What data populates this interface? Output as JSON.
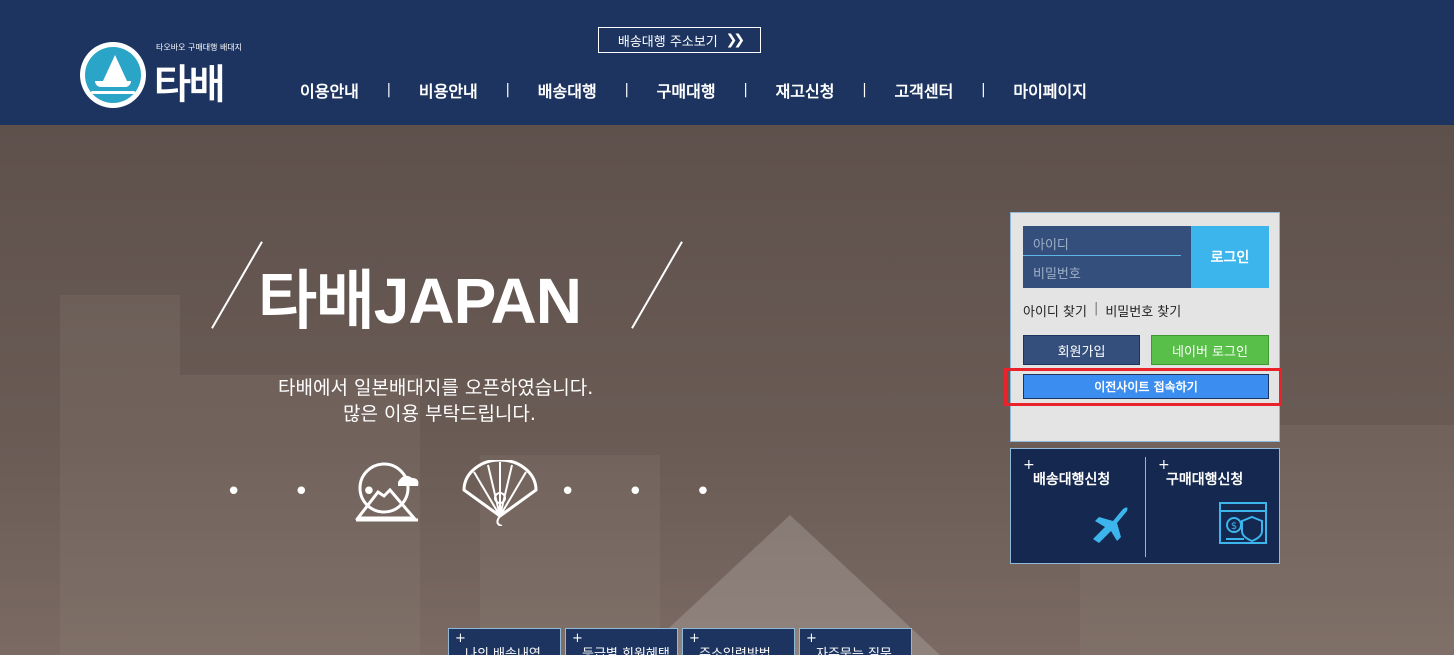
{
  "header": {
    "logo_tagline": "타오바오 구매대행 배대지",
    "logo_text": "타배",
    "address_button_label": "배송대행 주소보기",
    "nav": [
      "이용안내",
      "비용안내",
      "배송대행",
      "구매대행",
      "재고신청",
      "고객센터",
      "마이페이지"
    ],
    "nav_separator": "|"
  },
  "hero": {
    "title_kr": "타배",
    "title_en": "JAPAN",
    "subtitle_line1": "타배에서 일본배대지를 오픈하였습니다.",
    "subtitle_line2": "많은 이용 부탁드립니다.",
    "dots": "• • •",
    "icons": [
      "mount-fuji-icon",
      "folding-fan-icon"
    ]
  },
  "login": {
    "id_placeholder": "아이디",
    "password_placeholder": "비밀번호",
    "login_button": "로그인",
    "find_id": "아이디 찾기",
    "find_separator": "|",
    "find_password": "비밀번호 찾기",
    "join_button": "회원가입",
    "naver_button": "네이버 로그인",
    "previous_site_button": "이전사이트 접속하기"
  },
  "apply": {
    "plus": "+",
    "shipping_request": "배송대행신청",
    "purchase_request": "구매대행신청",
    "icons": [
      "airplane-icon",
      "payment-security-icon"
    ]
  },
  "bottom_tabs": {
    "plus": "+",
    "items": [
      "나의 배송내역",
      "등급별 회원혜택",
      "주소입력방법",
      "자주묻는 질문"
    ]
  },
  "colors": {
    "header_bg": "#1d3460",
    "login_blue": "#3cb4ec",
    "naver_green": "#58c048",
    "prev_site_blue": "#3b8ef0",
    "highlight_red": "#e8232a"
  }
}
